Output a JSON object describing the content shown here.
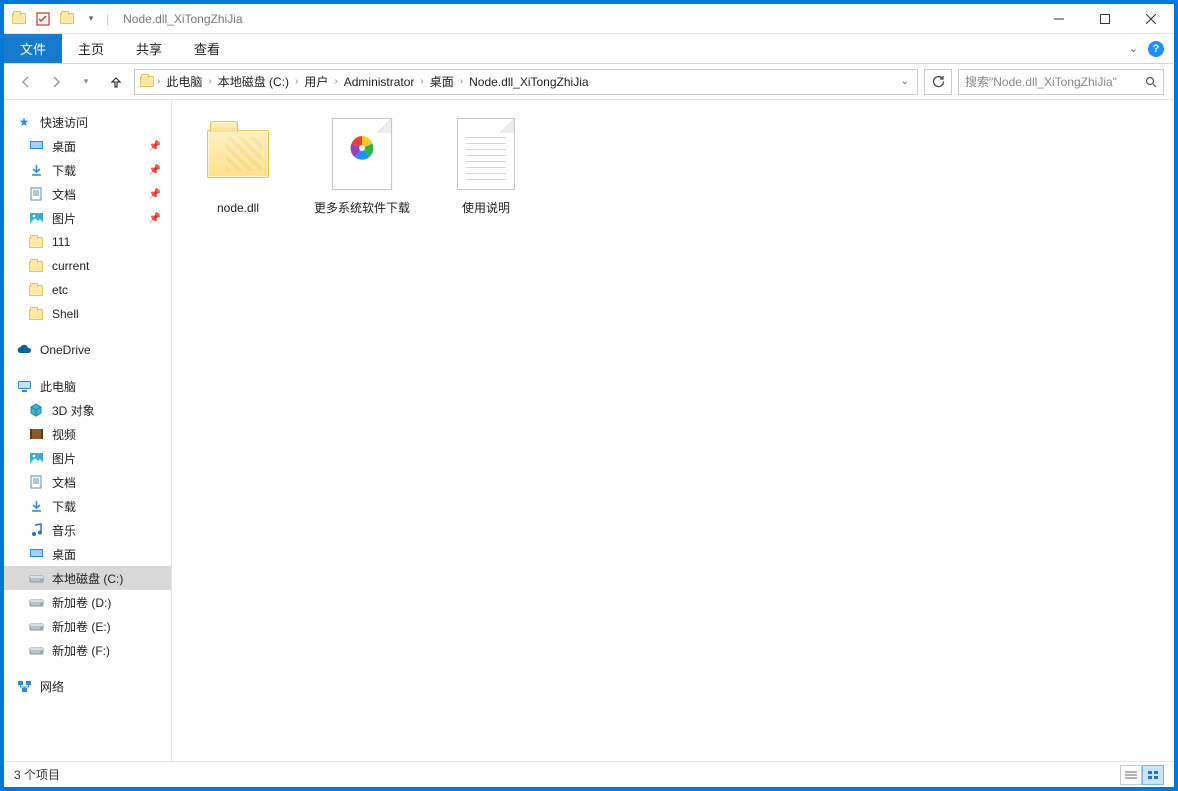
{
  "window": {
    "title": "Node.dll_XiTongZhiJia"
  },
  "ribbon": {
    "file": "文件",
    "tabs": [
      "主页",
      "共享",
      "查看"
    ]
  },
  "breadcrumb": {
    "segments": [
      "此电脑",
      "本地磁盘 (C:)",
      "用户",
      "Administrator",
      "桌面",
      "Node.dll_XiTongZhiJia"
    ]
  },
  "search": {
    "placeholder": "搜索\"Node.dll_XiTongZhiJia\""
  },
  "sidebar": {
    "quick_access_header": "快速访问",
    "quick_access": [
      {
        "label": "桌面",
        "pinned": true,
        "icon": "desktop"
      },
      {
        "label": "下载",
        "pinned": true,
        "icon": "download"
      },
      {
        "label": "文档",
        "pinned": true,
        "icon": "document"
      },
      {
        "label": "图片",
        "pinned": true,
        "icon": "pictures"
      },
      {
        "label": "111",
        "pinned": false,
        "icon": "folder"
      },
      {
        "label": "current",
        "pinned": false,
        "icon": "folder"
      },
      {
        "label": "etc",
        "pinned": false,
        "icon": "folder"
      },
      {
        "label": "Shell",
        "pinned": false,
        "icon": "folder"
      }
    ],
    "onedrive": "OneDrive",
    "this_pc_header": "此电脑",
    "this_pc": [
      {
        "label": "3D 对象",
        "icon": "3d"
      },
      {
        "label": "视频",
        "icon": "video"
      },
      {
        "label": "图片",
        "icon": "pictures"
      },
      {
        "label": "文档",
        "icon": "document"
      },
      {
        "label": "下载",
        "icon": "download"
      },
      {
        "label": "音乐",
        "icon": "music"
      },
      {
        "label": "桌面",
        "icon": "desktop"
      },
      {
        "label": "本地磁盘 (C:)",
        "icon": "drive",
        "selected": true
      },
      {
        "label": "新加卷 (D:)",
        "icon": "drive"
      },
      {
        "label": "新加卷 (E:)",
        "icon": "drive"
      },
      {
        "label": "新加卷 (F:)",
        "icon": "drive"
      }
    ],
    "network": "网络"
  },
  "files": [
    {
      "name": "node.dll",
      "type": "folder-dll"
    },
    {
      "name": "更多系统软件下载",
      "type": "shortcut-pinwheel"
    },
    {
      "name": "使用说明",
      "type": "text-doc"
    }
  ],
  "status": {
    "count_label": "3 个项目"
  }
}
